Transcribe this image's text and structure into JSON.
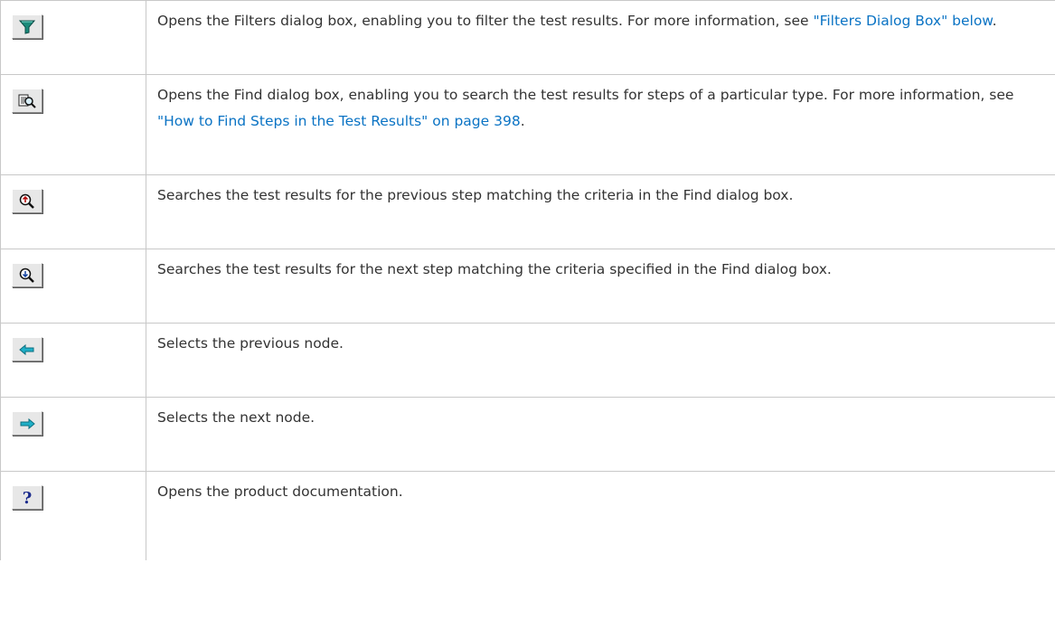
{
  "rows": [
    {
      "icon": "filter-icon",
      "segments": [
        {
          "text": "Opens the Filters dialog box, enabling you to filter the test results. For more information, see ",
          "link": false
        },
        {
          "text": "\"Filters Dialog Box\" below",
          "link": true
        },
        {
          "text": ".",
          "link": false
        }
      ]
    },
    {
      "icon": "find-icon",
      "segments": [
        {
          "text": "Opens the Find dialog box, enabling you to search the test results for steps of a particular type. For more information, see ",
          "link": false
        },
        {
          "text": "\"How to Find Steps in the Test Results\" on page 398",
          "link": true
        },
        {
          "text": ".",
          "link": false
        }
      ]
    },
    {
      "icon": "find-previous-icon",
      "segments": [
        {
          "text": "Searches the test results for the previous step matching the criteria in the Find dialog box.",
          "link": false
        }
      ]
    },
    {
      "icon": "find-next-icon",
      "segments": [
        {
          "text": "Searches the test results for the next step matching the criteria specified in the Find dialog box.",
          "link": false
        }
      ]
    },
    {
      "icon": "previous-node-icon",
      "segments": [
        {
          "text": "Selects the previous node.",
          "link": false
        }
      ]
    },
    {
      "icon": "next-node-icon",
      "segments": [
        {
          "text": "Selects the next node.",
          "link": false
        }
      ]
    },
    {
      "icon": "help-icon",
      "segments": [
        {
          "text": "Opens the product documentation.",
          "link": false
        }
      ]
    }
  ]
}
